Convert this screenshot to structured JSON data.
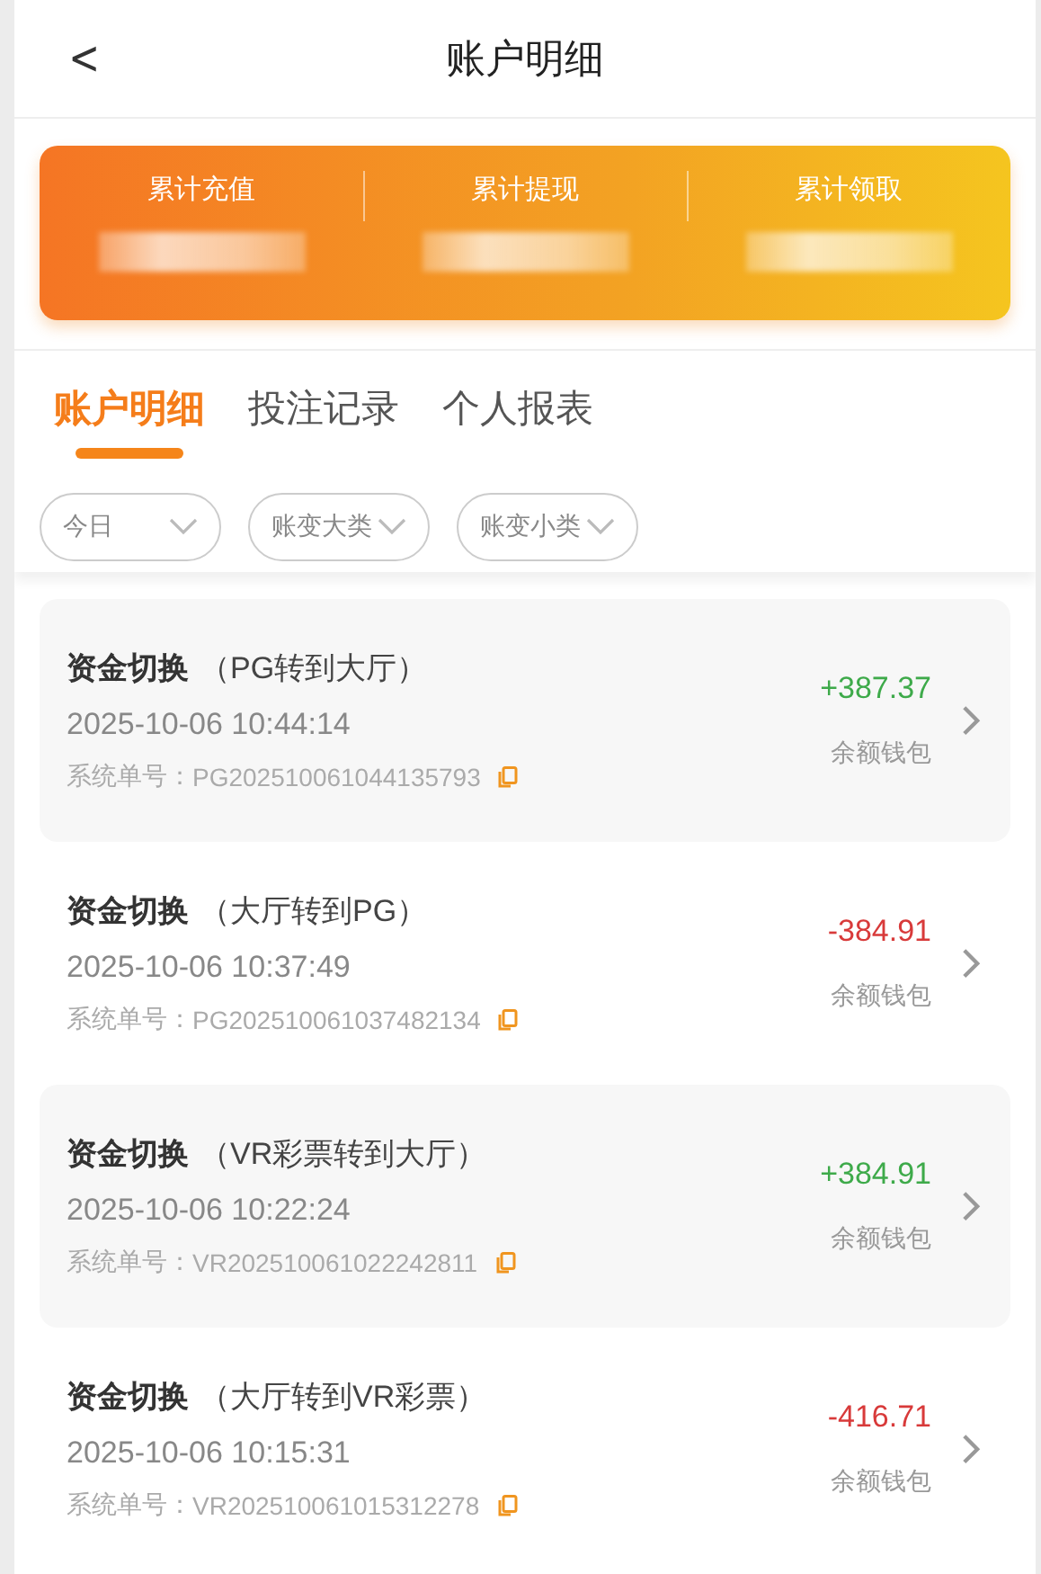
{
  "header": {
    "back": "<",
    "title": "账户明细"
  },
  "summary": [
    {
      "label": "累计充值"
    },
    {
      "label": "累计提现"
    },
    {
      "label": "累计领取"
    }
  ],
  "tabs": [
    {
      "label": "账户明细",
      "selected": true
    },
    {
      "label": "投注记录",
      "selected": false
    },
    {
      "label": "个人报表",
      "selected": false
    }
  ],
  "filters": [
    {
      "label": "今日"
    },
    {
      "label": "账变大类"
    },
    {
      "label": "账变小类"
    }
  ],
  "records": [
    {
      "title": "资金切换",
      "detail": "（PG转到大厅）",
      "time": "2025-10-06 10:44:14",
      "order_label": "系统单号：",
      "order_no": "PG202510061044135793",
      "amount": "+387.37",
      "kind": "credit",
      "wallet": "余额钱包"
    },
    {
      "title": "资金切换",
      "detail": "（大厅转到PG）",
      "time": "2025-10-06 10:37:49",
      "order_label": "系统单号：",
      "order_no": "PG202510061037482134",
      "amount": "-384.91",
      "kind": "debit",
      "wallet": "余额钱包"
    },
    {
      "title": "资金切换",
      "detail": "（VR彩票转到大厅）",
      "time": "2025-10-06 10:22:24",
      "order_label": "系统单号：",
      "order_no": "VR202510061022242811",
      "amount": "+384.91",
      "kind": "credit",
      "wallet": "余额钱包"
    },
    {
      "title": "资金切换",
      "detail": "（大厅转到VR彩票）",
      "time": "2025-10-06 10:15:31",
      "order_label": "系统单号：",
      "order_no": "VR202510061015312278",
      "amount": "-416.71",
      "kind": "debit",
      "wallet": "余额钱包"
    }
  ]
}
